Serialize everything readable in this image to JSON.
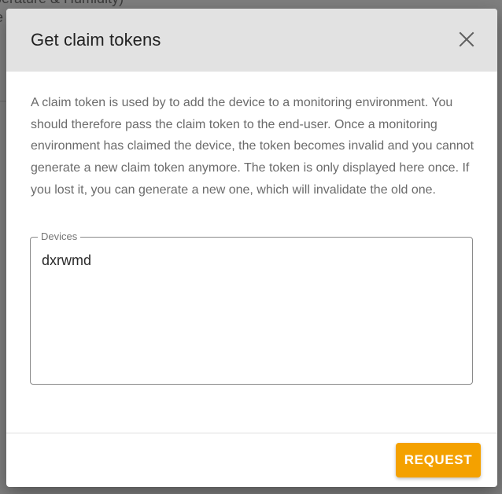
{
  "background": {
    "line1": "perature & Humidity)",
    "line2": "e",
    "line3": "r"
  },
  "dialog": {
    "title": "Get claim tokens",
    "close_icon": "close-icon",
    "description": "A claim token is used by to add the device to a monitoring environment. You should therefore pass the claim token to the end-user. Once a monitoring environment has claimed the device, the token becomes invalid and you cannot generate a new claim token anymore. The token is only displayed here once. If you lost it, you can generate a new one, which will invalidate the old one.",
    "devices_field": {
      "label": "Devices",
      "value": "dxrwmd"
    },
    "request_button": "REQUEST"
  },
  "colors": {
    "header_bg": "#e2e2e2",
    "accent": "#f4a100",
    "backdrop": "#7f7f7f"
  }
}
